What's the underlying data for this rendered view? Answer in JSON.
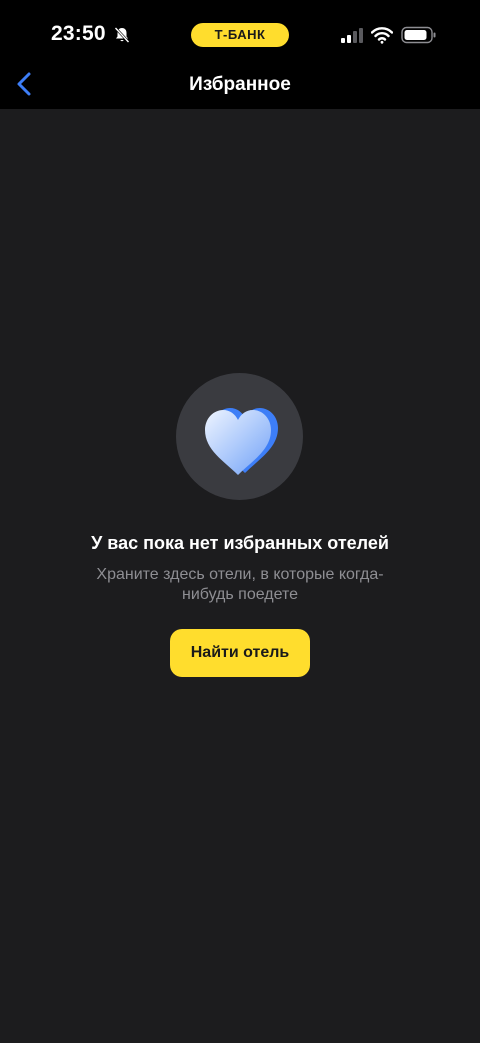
{
  "status_bar": {
    "time": "23:50",
    "bank_label": "Т-БАНК",
    "icons": [
      "bell-off-icon",
      "signal-icon",
      "wifi-icon",
      "battery-icon"
    ]
  },
  "header": {
    "title": "Избранное",
    "back_icon": "chevron-left-icon"
  },
  "empty_state": {
    "icon": "heart-icon",
    "title": "У вас пока нет избранных отелей",
    "subtitle": "Храните здесь отели, в которые когда-нибудь поедете",
    "button_label": "Найти отель"
  },
  "colors": {
    "accent": "#ffdd2d",
    "background": "#1c1c1e",
    "header_background": "#000000",
    "back_icon": "#3d7ef7",
    "heart": "#4b8bf5",
    "subtitle": "#8e8e93"
  }
}
